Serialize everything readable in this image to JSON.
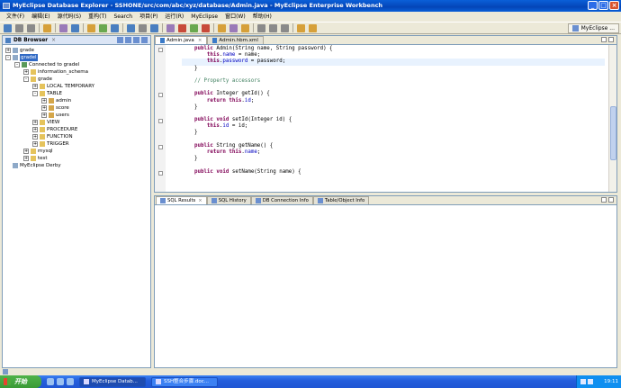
{
  "window": {
    "title": "MyEclipse Database Explorer - SSHONE/src/com/abc/xyz/database/Admin.java - MyEclipse Enterprise Workbench",
    "min_label": "_",
    "max_label": "□",
    "close_label": "×"
  },
  "menubar": {
    "items": [
      "文件(F)",
      "编辑(E)",
      "源代码(S)",
      "重构(T)",
      "Search",
      "项目(P)",
      "运行(R)",
      "MyEclipse",
      "窗口(W)",
      "帮助(H)"
    ]
  },
  "toolbar": {
    "perspective_label": "MyEclipse ..."
  },
  "db_browser": {
    "tab_label": "DB Browser",
    "close": "×",
    "tree": [
      {
        "label": "grade",
        "indent": 0,
        "exp": "+",
        "icon": "db"
      },
      {
        "label": "gradel",
        "indent": 0,
        "exp": "-",
        "icon": "db",
        "selected": true
      },
      {
        "label": "Connected to gradel",
        "indent": 1,
        "exp": "-",
        "icon": "conn"
      },
      {
        "label": "information_schema",
        "indent": 2,
        "exp": "+",
        "icon": "folder"
      },
      {
        "label": "grade",
        "indent": 2,
        "exp": "-",
        "icon": "folder"
      },
      {
        "label": "LOCAL TEMPORARY",
        "indent": 3,
        "exp": "+",
        "icon": "folder"
      },
      {
        "label": "TABLE",
        "indent": 3,
        "exp": "-",
        "icon": "folder"
      },
      {
        "label": "admin",
        "indent": 4,
        "exp": "+",
        "icon": "table"
      },
      {
        "label": "score",
        "indent": 4,
        "exp": "+",
        "icon": "table"
      },
      {
        "label": "users",
        "indent": 4,
        "exp": "+",
        "icon": "table"
      },
      {
        "label": "VIEW",
        "indent": 3,
        "exp": "+",
        "icon": "folder"
      },
      {
        "label": "PROCEDURE",
        "indent": 3,
        "exp": "+",
        "icon": "folder"
      },
      {
        "label": "FUNCTION",
        "indent": 3,
        "exp": "+",
        "icon": "folder"
      },
      {
        "label": "TRIGGER",
        "indent": 3,
        "exp": "+",
        "icon": "folder"
      },
      {
        "label": "mysql",
        "indent": 2,
        "exp": "+",
        "icon": "folder"
      },
      {
        "label": "test",
        "indent": 2,
        "exp": "+",
        "icon": "folder"
      },
      {
        "label": "MyEclipse Derby",
        "indent": 0,
        "exp": "",
        "icon": "db"
      }
    ]
  },
  "editor": {
    "tabs": [
      {
        "label": "Admin.java",
        "active": true,
        "close": "×"
      },
      {
        "label": "Admin.hbm.xml",
        "active": false,
        "close": ""
      }
    ],
    "lines": [
      [
        {
          "t": "    "
        },
        {
          "c": "kw",
          "t": "public"
        },
        {
          "t": " Admin(String name, String password) {"
        }
      ],
      [
        {
          "t": "        "
        },
        {
          "c": "kw",
          "t": "this"
        },
        {
          "t": "."
        },
        {
          "c": "fd",
          "t": "name"
        },
        {
          "t": " = name;"
        }
      ],
      [
        {
          "t": "        "
        },
        {
          "c": "kw",
          "t": "this"
        },
        {
          "t": "."
        },
        {
          "c": "fd",
          "t": "password"
        },
        {
          "t": " = password;"
        }
      ],
      [
        {
          "t": "    }"
        }
      ],
      [
        {
          "t": ""
        }
      ],
      [
        {
          "t": "    "
        },
        {
          "c": "cm",
          "t": "// Property accessors"
        }
      ],
      [
        {
          "t": ""
        }
      ],
      [
        {
          "t": "    "
        },
        {
          "c": "kw",
          "t": "public"
        },
        {
          "t": " Integer getId() {"
        }
      ],
      [
        {
          "t": "        "
        },
        {
          "c": "kw",
          "t": "return"
        },
        {
          "t": " "
        },
        {
          "c": "kw",
          "t": "this"
        },
        {
          "t": "."
        },
        {
          "c": "fd",
          "t": "id"
        },
        {
          "t": ";"
        }
      ],
      [
        {
          "t": "    }"
        }
      ],
      [
        {
          "t": ""
        }
      ],
      [
        {
          "t": "    "
        },
        {
          "c": "kw",
          "t": "public"
        },
        {
          "t": " "
        },
        {
          "c": "kw",
          "t": "void"
        },
        {
          "t": " setId(Integer id) {"
        }
      ],
      [
        {
          "t": "        "
        },
        {
          "c": "kw",
          "t": "this"
        },
        {
          "t": "."
        },
        {
          "c": "fd",
          "t": "id"
        },
        {
          "t": " = id;"
        }
      ],
      [
        {
          "t": "    }"
        }
      ],
      [
        {
          "t": ""
        }
      ],
      [
        {
          "t": "    "
        },
        {
          "c": "kw",
          "t": "public"
        },
        {
          "t": " String getName() {"
        }
      ],
      [
        {
          "t": "        "
        },
        {
          "c": "kw",
          "t": "return"
        },
        {
          "t": " "
        },
        {
          "c": "kw",
          "t": "this"
        },
        {
          "t": "."
        },
        {
          "c": "fd",
          "t": "name"
        },
        {
          "t": ";"
        }
      ],
      [
        {
          "t": "    }"
        }
      ],
      [
        {
          "t": ""
        }
      ],
      [
        {
          "t": "    "
        },
        {
          "c": "kw",
          "t": "public"
        },
        {
          "t": " "
        },
        {
          "c": "kw",
          "t": "void"
        },
        {
          "t": " setName(String name) {"
        }
      ]
    ]
  },
  "bottom_panel": {
    "tabs": [
      {
        "label": "SQL Results",
        "active": true,
        "close": "×"
      },
      {
        "label": "SQL History",
        "active": false,
        "close": ""
      },
      {
        "label": "DB Connection Info",
        "active": false,
        "close": ""
      },
      {
        "label": "Table/Object Info",
        "active": false,
        "close": ""
      }
    ]
  },
  "taskbar": {
    "start_label": "开始",
    "tasks": [
      {
        "label": "MyEclipse Datab...",
        "active": true
      },
      {
        "label": "SSH整合步骤.doc...",
        "active": false
      }
    ],
    "clock": "19:11"
  },
  "colors": {
    "keyword": "#7f0055",
    "comment": "#3f7f5f",
    "field": "#0000c0",
    "selection": "#316ac5"
  }
}
